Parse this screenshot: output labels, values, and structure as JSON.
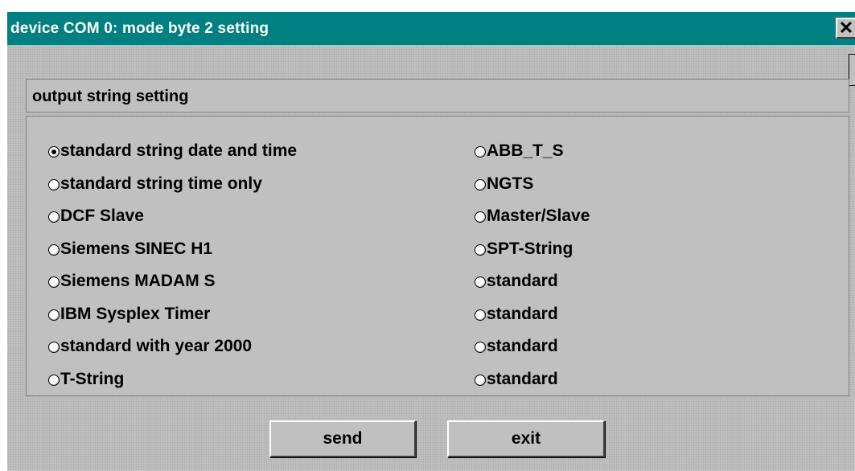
{
  "window": {
    "title": "device COM 0: mode byte 2 setting",
    "close_label": "✕"
  },
  "group": {
    "title": "output string setting"
  },
  "options": {
    "left": [
      {
        "label": "standard string date and time",
        "checked": true
      },
      {
        "label": "standard string time only",
        "checked": false
      },
      {
        "label": "DCF Slave",
        "checked": false
      },
      {
        "label": "Siemens SINEC H1",
        "checked": false
      },
      {
        "label": "Siemens MADAM S",
        "checked": false
      },
      {
        "label": "IBM Sysplex Timer",
        "checked": false
      },
      {
        "label": "standard with year 2000",
        "checked": false
      },
      {
        "label": "T-String",
        "checked": false
      }
    ],
    "right": [
      {
        "label": "ABB_T_S",
        "checked": false
      },
      {
        "label": "NGTS",
        "checked": false
      },
      {
        "label": "Master/Slave",
        "checked": false
      },
      {
        "label": "SPT-String",
        "checked": false
      },
      {
        "label": "standard",
        "checked": false
      },
      {
        "label": "standard",
        "checked": false
      },
      {
        "label": "standard",
        "checked": false
      },
      {
        "label": "standard",
        "checked": false
      }
    ]
  },
  "buttons": {
    "send_label": "send",
    "exit_label": "exit"
  },
  "colors": {
    "titlebar": "#008080",
    "face": "#c0c0c0"
  }
}
